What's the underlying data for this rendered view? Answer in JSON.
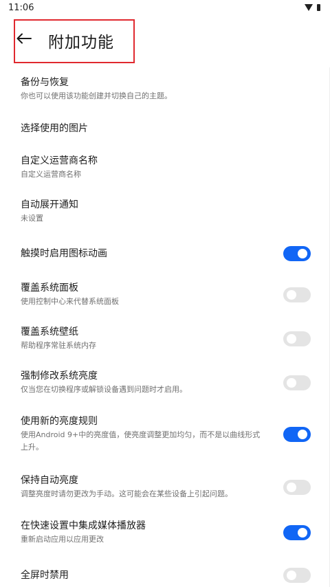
{
  "status": {
    "time": "11:06"
  },
  "header": {
    "title": "附加功能"
  },
  "items": [
    {
      "title": "备份与恢复",
      "subtitle": "你也可以使用该功能创建并切换自己的主题。"
    },
    {
      "title": "选择使用的图片"
    },
    {
      "title": "自定义运营商名称",
      "subtitle": "自定义运营商名称"
    },
    {
      "title": "自动展开通知",
      "subtitle": "未设置"
    },
    {
      "title": "触摸时启用图标动画",
      "toggle": true
    },
    {
      "title": "覆盖系统面板",
      "subtitle": "使用控制中心来代替系统面板",
      "toggle": false
    },
    {
      "title": "覆盖系统壁纸",
      "subtitle": "帮助程序常驻系统内存",
      "toggle": false
    },
    {
      "title": "强制修改系统亮度",
      "subtitle": "仅当您在切换程序或解锁设备遇到问题时才启用。",
      "toggle": false
    },
    {
      "title": "使用新的亮度规则",
      "subtitle": "使用Android 9+中的亮度值，使亮度调整更加均匀，而不是以曲线形式上升。",
      "toggle": true
    },
    {
      "title": "保持自动亮度",
      "subtitle": "调整亮度时请勿更改为手动。这可能会在某些设备上引起问题。",
      "toggle": false
    },
    {
      "title": "在快速设置中集成媒体播放器",
      "subtitle": "重新启动应用以应用更改",
      "toggle": true
    },
    {
      "title": "全屏时禁用",
      "toggle": false
    }
  ],
  "colors": {
    "toggle_on": "#1166f5",
    "toggle_off": "#e4e4e4",
    "highlight": "#e0282e"
  }
}
